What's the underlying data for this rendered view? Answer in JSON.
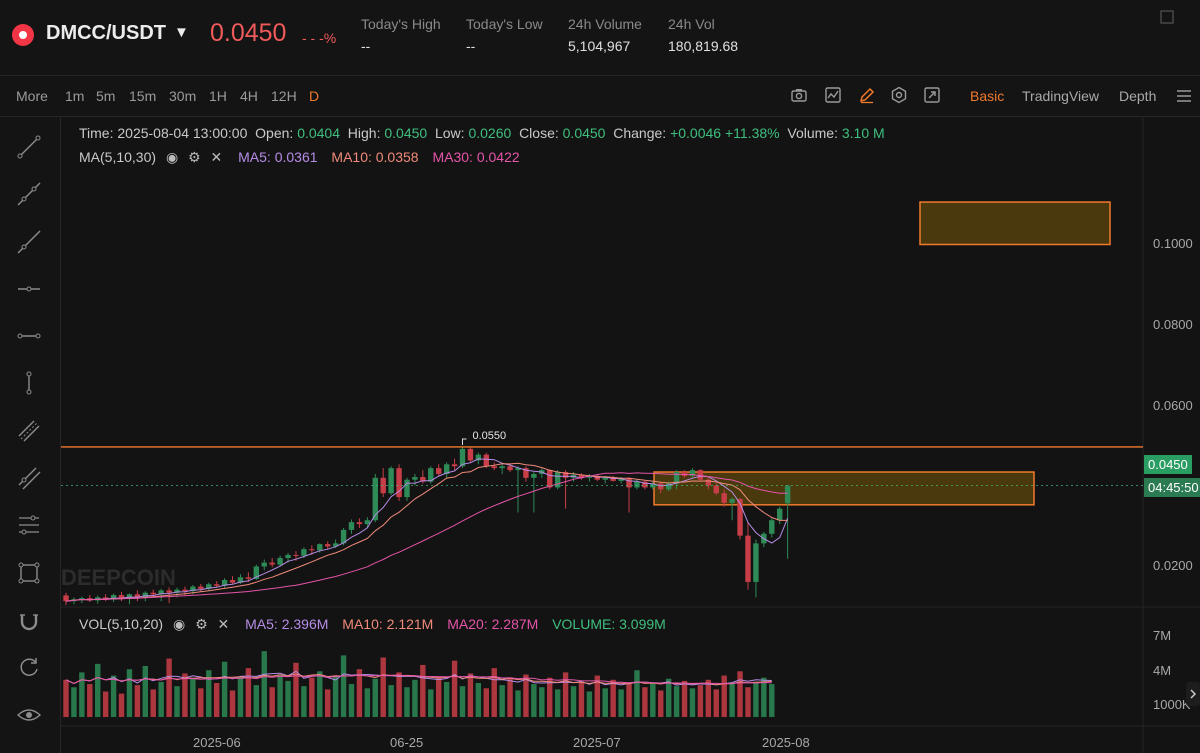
{
  "header": {
    "pair": "DMCC/USDT",
    "price": "0.0450",
    "change_pct": "- - -%",
    "stats": [
      {
        "label": "Today's High",
        "value": "--"
      },
      {
        "label": "Today's Low",
        "value": "--"
      },
      {
        "label": "24h Volume",
        "value": "5,104,967"
      },
      {
        "label": "24h Vol",
        "value": "180,819.68"
      }
    ]
  },
  "toolbar": {
    "more": "More",
    "timeframes": [
      "1m",
      "5m",
      "15m",
      "30m",
      "1H",
      "4H",
      "12H",
      "D"
    ],
    "active_timeframe": "D",
    "views": [
      "Basic",
      "TradingView",
      "Depth"
    ],
    "active_view": "Basic"
  },
  "ohlc": {
    "time_label": "Time:",
    "time": "2025-08-04 13:00:00",
    "open_label": "Open:",
    "open": "0.0404",
    "high_label": "High:",
    "high": "0.0450",
    "low_label": "Low:",
    "low": "0.0260",
    "close_label": "Close:",
    "close": "0.0450",
    "change_label": "Change:",
    "change": "+0.0046 +11.38%",
    "volume_label": "Volume:",
    "volume": "3.10 M"
  },
  "ma": {
    "title": "MA(5,10,30)",
    "ma5": "MA5: 0.0361",
    "ma10": "MA10: 0.0358",
    "ma30": "MA30: 0.0422"
  },
  "vol": {
    "title": "VOL(5,10,20)",
    "ma5": "MA5: 2.396M",
    "ma10": "MA10: 2.121M",
    "ma20": "MA20: 2.287M",
    "volume": "VOLUME: 3.099M"
  },
  "price_axis": [
    "0.1000",
    "0.0800",
    "0.0600",
    "0.0200"
  ],
  "vol_axis": [
    "7M",
    "4M",
    "1000K"
  ],
  "current_price_tag": "0.0450",
  "countdown_tag": "04:45:50",
  "peak_label": "0.0550",
  "watermark": "DEEPCOIN",
  "x_axis": [
    "2025-06",
    "06-25",
    "2025-07",
    "2025-08"
  ],
  "colors": {
    "up": "#2e8b57",
    "down": "#c83e48",
    "accent": "#f07a2c"
  },
  "chart_data": {
    "type": "candlestick",
    "title": "DMCC/USDT D",
    "ylim": [
      0.0135,
      0.125
    ],
    "x": [
      "2025-06",
      "06-25",
      "2025-07",
      "2025-08"
    ],
    "candles": [
      [
        0.0165,
        0.0172,
        0.014,
        0.015
      ],
      [
        0.015,
        0.016,
        0.0142,
        0.0155
      ],
      [
        0.0155,
        0.0162,
        0.0145,
        0.0158
      ],
      [
        0.0158,
        0.0166,
        0.0148,
        0.0152
      ],
      [
        0.0152,
        0.0165,
        0.0144,
        0.016
      ],
      [
        0.016,
        0.0168,
        0.015,
        0.0154
      ],
      [
        0.0154,
        0.017,
        0.0148,
        0.0166
      ],
      [
        0.0166,
        0.0174,
        0.015,
        0.0156
      ],
      [
        0.0156,
        0.017,
        0.0142,
        0.0168
      ],
      [
        0.0168,
        0.0178,
        0.015,
        0.016
      ],
      [
        0.016,
        0.0176,
        0.015,
        0.0172
      ],
      [
        0.0172,
        0.018,
        0.016,
        0.0168
      ],
      [
        0.0168,
        0.0182,
        0.015,
        0.0178
      ],
      [
        0.0178,
        0.0186,
        0.0145,
        0.0172
      ],
      [
        0.0172,
        0.0185,
        0.016,
        0.018
      ],
      [
        0.018,
        0.0188,
        0.0165,
        0.0176
      ],
      [
        0.0176,
        0.0192,
        0.0168,
        0.0188
      ],
      [
        0.0188,
        0.0195,
        0.0175,
        0.0182
      ],
      [
        0.0182,
        0.0198,
        0.0176,
        0.0194
      ],
      [
        0.0194,
        0.0202,
        0.0185,
        0.019
      ],
      [
        0.019,
        0.021,
        0.0185,
        0.0205
      ],
      [
        0.0205,
        0.0215,
        0.0195,
        0.0198
      ],
      [
        0.0198,
        0.022,
        0.0195,
        0.0212
      ],
      [
        0.0212,
        0.0225,
        0.02,
        0.0208
      ],
      [
        0.0208,
        0.0245,
        0.0205,
        0.024
      ],
      [
        0.024,
        0.0258,
        0.023,
        0.025
      ],
      [
        0.025,
        0.0262,
        0.0238,
        0.0245
      ],
      [
        0.0245,
        0.0268,
        0.024,
        0.0262
      ],
      [
        0.0262,
        0.0275,
        0.025,
        0.027
      ],
      [
        0.027,
        0.028,
        0.0255,
        0.0268
      ],
      [
        0.0268,
        0.029,
        0.0262,
        0.0285
      ],
      [
        0.0285,
        0.0295,
        0.027,
        0.0282
      ],
      [
        0.0282,
        0.03,
        0.0276,
        0.0298
      ],
      [
        0.0298,
        0.0305,
        0.0285,
        0.0292
      ],
      [
        0.0292,
        0.031,
        0.0288,
        0.03
      ],
      [
        0.03,
        0.034,
        0.0295,
        0.0335
      ],
      [
        0.0335,
        0.0362,
        0.0325,
        0.0355
      ],
      [
        0.0355,
        0.0365,
        0.034,
        0.035
      ],
      [
        0.035,
        0.0368,
        0.034,
        0.036
      ],
      [
        0.036,
        0.048,
        0.0355,
        0.047
      ],
      [
        0.047,
        0.0495,
        0.042,
        0.043
      ],
      [
        0.043,
        0.05,
        0.0425,
        0.0495
      ],
      [
        0.0495,
        0.0505,
        0.041,
        0.042
      ],
      [
        0.042,
        0.047,
        0.041,
        0.0465
      ],
      [
        0.0465,
        0.048,
        0.045,
        0.0472
      ],
      [
        0.0472,
        0.049,
        0.0455,
        0.046
      ],
      [
        0.046,
        0.05,
        0.0455,
        0.0495
      ],
      [
        0.0495,
        0.0505,
        0.0475,
        0.048
      ],
      [
        0.048,
        0.051,
        0.047,
        0.0505
      ],
      [
        0.0505,
        0.052,
        0.049,
        0.05
      ],
      [
        0.05,
        0.055,
        0.0495,
        0.0545
      ],
      [
        0.0545,
        0.055,
        0.051,
        0.0515
      ],
      [
        0.0515,
        0.0535,
        0.0505,
        0.053
      ],
      [
        0.053,
        0.0535,
        0.0495,
        0.05
      ],
      [
        0.05,
        0.051,
        0.049,
        0.0495
      ],
      [
        0.0495,
        0.0505,
        0.048,
        0.05
      ],
      [
        0.05,
        0.0505,
        0.0485,
        0.049
      ],
      [
        0.049,
        0.05,
        0.038,
        0.0495
      ],
      [
        0.0495,
        0.05,
        0.046,
        0.047
      ],
      [
        0.047,
        0.0485,
        0.038,
        0.048
      ],
      [
        0.048,
        0.0495,
        0.047,
        0.049
      ],
      [
        0.049,
        0.0492,
        0.044,
        0.0445
      ],
      [
        0.0445,
        0.049,
        0.044,
        0.0485
      ],
      [
        0.0485,
        0.049,
        0.039,
        0.047
      ],
      [
        0.047,
        0.0485,
        0.046,
        0.0478
      ],
      [
        0.0478,
        0.0482,
        0.0465,
        0.047
      ],
      [
        0.047,
        0.048,
        0.046,
        0.0475
      ],
      [
        0.0475,
        0.0478,
        0.0462,
        0.0465
      ],
      [
        0.0465,
        0.0475,
        0.0455,
        0.047
      ],
      [
        0.047,
        0.0475,
        0.046,
        0.0462
      ],
      [
        0.0462,
        0.0472,
        0.0455,
        0.0468
      ],
      [
        0.0468,
        0.0472,
        0.038,
        0.0445
      ],
      [
        0.0445,
        0.0465,
        0.044,
        0.046
      ],
      [
        0.046,
        0.0462,
        0.044,
        0.0445
      ],
      [
        0.0445,
        0.046,
        0.044,
        0.0455
      ],
      [
        0.0455,
        0.0458,
        0.043,
        0.044
      ],
      [
        0.044,
        0.046,
        0.0435,
        0.0455
      ],
      [
        0.0455,
        0.049,
        0.044,
        0.0485
      ],
      [
        0.0485,
        0.049,
        0.047,
        0.0475
      ],
      [
        0.0475,
        0.0495,
        0.047,
        0.049
      ],
      [
        0.049,
        0.0492,
        0.046,
        0.0465
      ],
      [
        0.0465,
        0.047,
        0.044,
        0.045
      ],
      [
        0.045,
        0.0455,
        0.0425,
        0.043
      ],
      [
        0.043,
        0.044,
        0.0395,
        0.0405
      ],
      [
        0.0405,
        0.042,
        0.036,
        0.0415
      ],
      [
        0.0415,
        0.0418,
        0.031,
        0.032
      ],
      [
        0.032,
        0.0355,
        0.018,
        0.02
      ],
      [
        0.02,
        0.031,
        0.016,
        0.03
      ],
      [
        0.03,
        0.033,
        0.029,
        0.0325
      ],
      [
        0.0325,
        0.0365,
        0.0315,
        0.036
      ],
      [
        0.036,
        0.0395,
        0.035,
        0.039
      ],
      [
        0.0404,
        0.045,
        0.026,
        0.045
      ]
    ],
    "volume": [
      3.5,
      2.8,
      4.2,
      3.1,
      5.0,
      2.4,
      3.9,
      2.2,
      4.5,
      3.0,
      4.8,
      2.6,
      3.3,
      5.5,
      2.9,
      4.1,
      3.6,
      2.7,
      4.4,
      3.2,
      5.2,
      2.5,
      3.8,
      4.6,
      3.0,
      6.2,
      2.8,
      4.0,
      3.4,
      5.1,
      2.9,
      3.7,
      4.3,
      2.6,
      3.9,
      5.8,
      3.1,
      4.5,
      2.7,
      3.6,
      5.6,
      3.0,
      4.2,
      2.8,
      3.5,
      4.9,
      2.6,
      3.8,
      3.3,
      5.3,
      2.9,
      4.1,
      3.2,
      2.7,
      4.6,
      3.0,
      3.6,
      2.5,
      4.0,
      3.1,
      2.8,
      3.7,
      2.6,
      4.2,
      2.9,
      3.3,
      2.4,
      3.9,
      2.7,
      3.5,
      2.6,
      3.1,
      4.4,
      2.8,
      3.2,
      2.5,
      3.6,
      2.9,
      3.4,
      2.7,
      3.0,
      3.5,
      2.6,
      3.9,
      3.2,
      4.3,
      2.8,
      3.3,
      3.7,
      3.1
    ],
    "vol_ylim": [
      0,
      8.0
    ],
    "horizontal_line": 0.055
  }
}
